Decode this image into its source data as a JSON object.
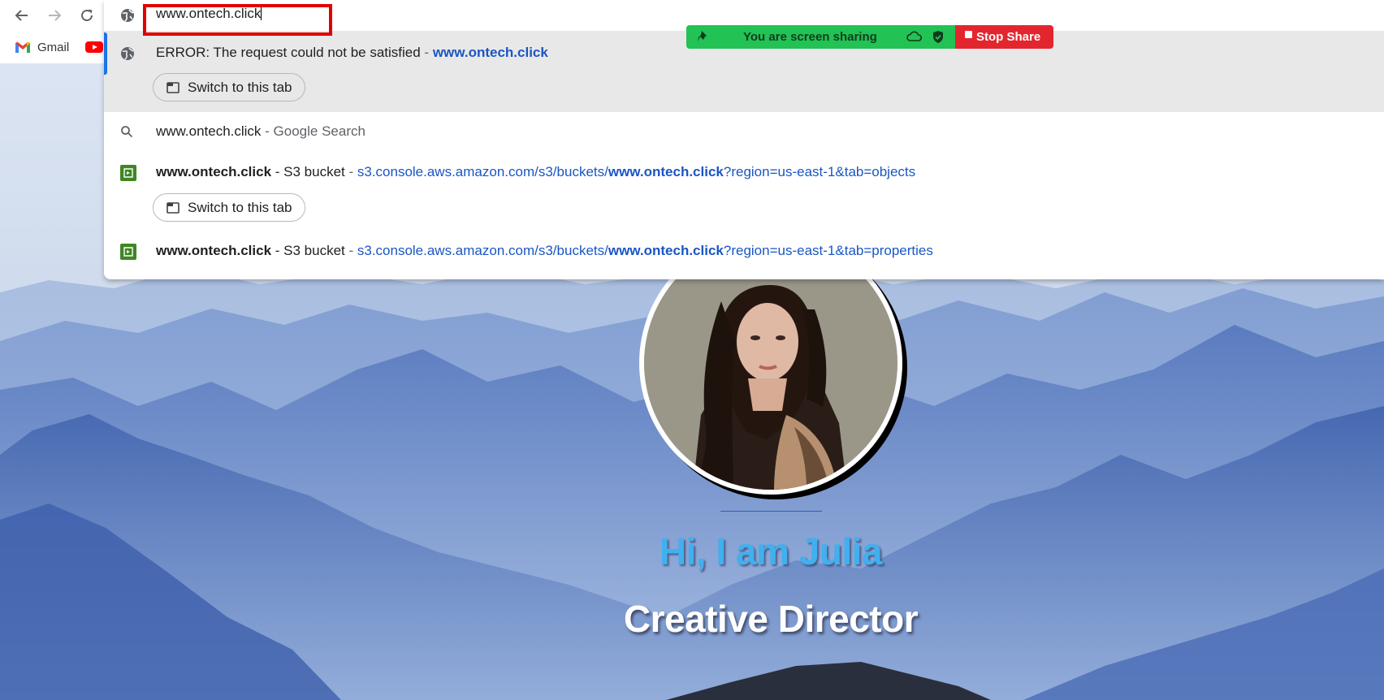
{
  "browser": {
    "address_value": "www.ontech.click",
    "bookmarks": [
      {
        "label": "Gmail",
        "icon": "gmail-icon"
      },
      {
        "label": "",
        "icon": "youtube-icon"
      }
    ]
  },
  "suggestions": [
    {
      "type": "history",
      "icon": "globe-icon",
      "title": "ERROR: The request could not be satisfied",
      "separator": " - ",
      "url_bold": "www.ontech.click",
      "button": "Switch to this tab",
      "selected": true
    },
    {
      "type": "search",
      "icon": "search-icon",
      "query": "www.ontech.click",
      "separator": " - ",
      "engine": "Google Search"
    },
    {
      "type": "tab",
      "icon": "s3-icon",
      "title_bold": "www.ontech.click",
      "title_rest": " - S3 bucket",
      "separator": " - ",
      "url_prefix": "s3.console.aws.amazon.com/s3/buckets/",
      "url_bold": "www.ontech.click",
      "url_suffix": "?region=us-east-1&tab=objects",
      "button": "Switch to this tab"
    },
    {
      "type": "tab",
      "icon": "s3-icon",
      "title_bold": "www.ontech.click",
      "title_rest": " - S3 bucket",
      "separator": " - ",
      "url_prefix": "s3.console.aws.amazon.com/s3/buckets/",
      "url_bold": "www.ontech.click",
      "url_suffix": "?region=us-east-1&tab=properties"
    }
  ],
  "share_banner": {
    "status": "You are screen sharing",
    "stop_label": "Stop Share",
    "colors": {
      "active": "#22c254",
      "stop": "#e3262e"
    }
  },
  "hero": {
    "greeting": "Hi, I am Julia",
    "title": "Creative Director"
  },
  "colors": {
    "url_blue": "#1a56c4",
    "highlight_red": "#e00000",
    "greeting_blue": "#3fb0f0"
  }
}
